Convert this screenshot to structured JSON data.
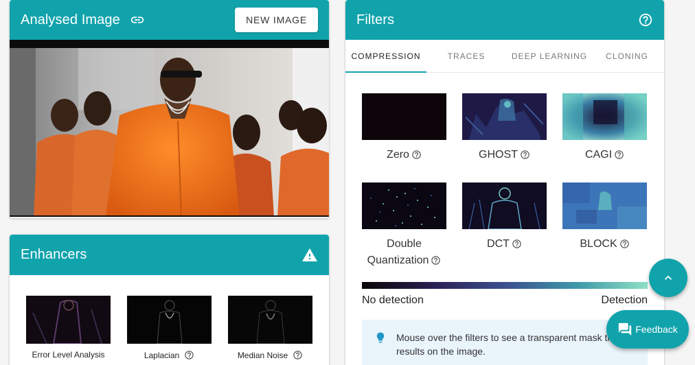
{
  "analysed": {
    "title": "Analysed Image",
    "new_image_label": "NEW IMAGE"
  },
  "enhancers": {
    "title": "Enhancers",
    "items": [
      {
        "label": "Error Level Analysis"
      },
      {
        "label": "Laplacian"
      },
      {
        "label": "Median Noise"
      }
    ]
  },
  "filters": {
    "title": "Filters",
    "tabs": [
      "COMPRESSION",
      "TRACES",
      "DEEP LEARNING",
      "CLONING"
    ],
    "active_tab": "COMPRESSION",
    "items": [
      {
        "label": "Zero"
      },
      {
        "label": "GHOST"
      },
      {
        "label": "CAGI"
      },
      {
        "label": "Double Quantization"
      },
      {
        "label": "DCT"
      },
      {
        "label": "BLOCK"
      }
    ],
    "scale_left": "No detection",
    "scale_right": "Detection",
    "info_text": "Mouse over the filters to see a transparent mask the results on the image."
  },
  "feedback_label": "Feedback",
  "colors": {
    "accent": "#11a3ac",
    "info_bg": "#e9f4fb"
  },
  "icons": [
    "link-icon",
    "warning-icon",
    "help-icon",
    "lightbulb-icon",
    "chevron-up-icon",
    "feedback-icon"
  ]
}
